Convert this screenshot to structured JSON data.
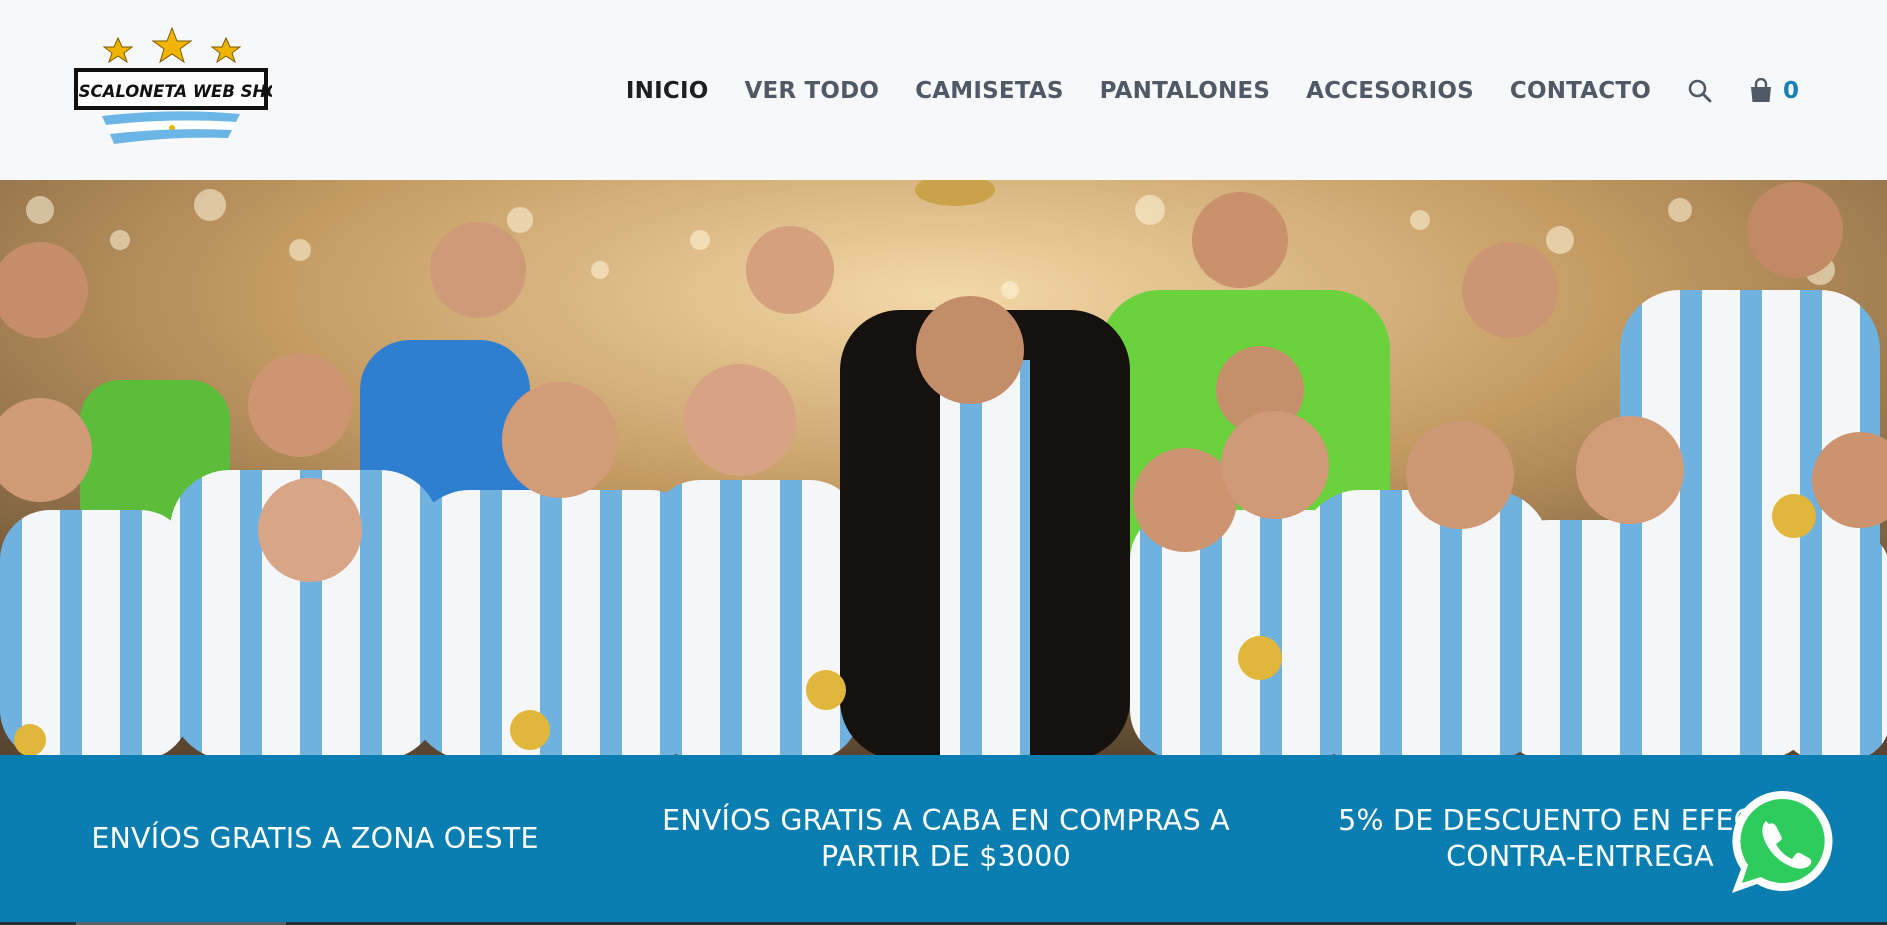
{
  "brand": {
    "logo_text": "LA SCALONETA WEB SHOP",
    "logo_icon": "argentina-flag-stars-logo"
  },
  "nav": {
    "items": [
      {
        "label": "INICIO",
        "active": true
      },
      {
        "label": "VER TODO",
        "active": false
      },
      {
        "label": "CAMISETAS",
        "active": false
      },
      {
        "label": "PANTALONES",
        "active": false
      },
      {
        "label": "ACCESORIOS",
        "active": false
      },
      {
        "label": "CONTACTO",
        "active": false
      }
    ],
    "search_icon": "search-icon",
    "cart_icon": "shopping-bag-icon",
    "cart_count": "0"
  },
  "hero": {
    "image_icon": "team-celebration-photo"
  },
  "promo": {
    "items": [
      {
        "text": "ENVÍOS GRATIS A ZONA OESTE"
      },
      {
        "text": "ENVÍOS GRATIS A CABA EN COMPRAS A PARTIR DE $3000"
      },
      {
        "text": "5% DE DESCUENTO EN EFECTIVO CONTRA-ENTREGA"
      }
    ]
  },
  "whatsapp": {
    "icon": "whatsapp-icon"
  },
  "colors": {
    "header_bg": "#f7f8f9",
    "nav_text": "#505a66",
    "nav_active": "#1b1e22",
    "accent": "#1680b5",
    "promo_bg": "#0a7eb0",
    "whatsapp_green": "#2ecc5c"
  }
}
